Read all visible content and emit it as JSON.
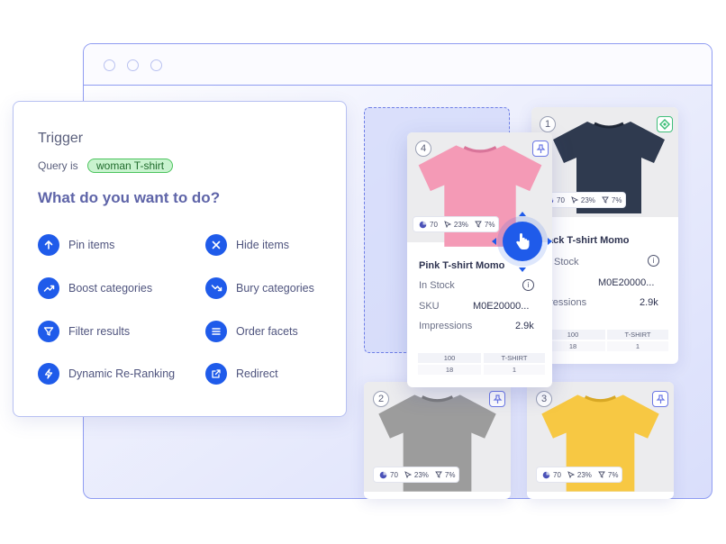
{
  "panel": {
    "heading": "Trigger",
    "query_label": "Query is",
    "query_value": "woman T-shirt",
    "question": "What do you want to do?",
    "actions": [
      {
        "label": "Pin items",
        "icon": "arrow-up-icon"
      },
      {
        "label": "Hide items",
        "icon": "close-icon"
      },
      {
        "label": "Boost categories",
        "icon": "trend-up-icon"
      },
      {
        "label": "Bury categories",
        "icon": "trend-down-icon"
      },
      {
        "label": "Filter results",
        "icon": "funnel-icon"
      },
      {
        "label": "Order facets",
        "icon": "list-icon"
      },
      {
        "label": "Dynamic Re-Ranking",
        "icon": "lightning-icon"
      },
      {
        "label": "Redirect",
        "icon": "external-link-icon"
      }
    ]
  },
  "cards": {
    "card1": {
      "position": "1",
      "stats": {
        "views": "70",
        "clicks": "23%",
        "filter": "7%"
      },
      "name": "ack T-shirt Momo",
      "stock": "Stock",
      "sku_value": "M0E20000...",
      "impressions_label": "pressions",
      "impressions_value": "2.9k",
      "table": {
        "h1": "100",
        "h2": "T-SHIRT",
        "v1": "18",
        "v2": "1"
      }
    },
    "card4": {
      "position": "4",
      "stats": {
        "views": "70",
        "clicks": "23%",
        "filter": "7%"
      },
      "name": "Pink T-shirt Momo",
      "stock": "In Stock",
      "sku_label": "SKU",
      "sku_value": "M0E20000...",
      "impressions_label": "Impressions",
      "impressions_value": "2.9k",
      "table": {
        "h1": "100",
        "h2": "T-SHIRT",
        "v1": "18",
        "v2": "1"
      }
    },
    "card2": {
      "position": "2",
      "stats": {
        "views": "70",
        "clicks": "23%",
        "filter": "7%"
      }
    },
    "card3": {
      "position": "3",
      "stats": {
        "views": "70",
        "clicks": "23%",
        "filter": "7%"
      }
    }
  },
  "colors": {
    "accent": "#1f5bea",
    "chip_bg": "#c9f3cf",
    "shirt_navy": "#2f3a4f",
    "shirt_pink": "#f49ab6",
    "shirt_grey": "#9c9c9c",
    "shirt_yellow": "#f7c843"
  }
}
